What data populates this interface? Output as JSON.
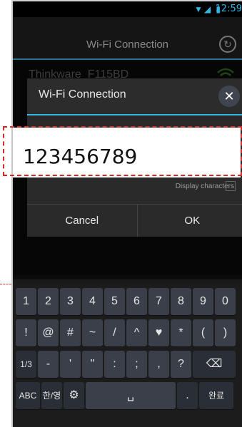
{
  "status_bar": {
    "time": "12:59"
  },
  "app_bar": {
    "title": "Wi-Fi Connection"
  },
  "network": {
    "name": "Thinkware_F115BD"
  },
  "dialog": {
    "title": "Wi-Fi Connection",
    "password_value": "123456789",
    "display_characters_label": "Display characters",
    "cancel_label": "Cancel",
    "ok_label": "OK"
  },
  "keyboard": {
    "row1": [
      "1",
      "2",
      "3",
      "4",
      "5",
      "6",
      "7",
      "8",
      "9",
      "0"
    ],
    "row2": [
      "!",
      "@",
      "#",
      "~",
      "/",
      "^",
      "♥",
      "*",
      "(",
      ")"
    ],
    "row3": [
      "1/3",
      "-",
      "'",
      "\"",
      ":",
      ";",
      ",",
      "?",
      "⌫"
    ],
    "row4": [
      "ABC",
      "한/영",
      "⚙",
      "␣",
      ".",
      "완료"
    ]
  },
  "colors": {
    "accent": "#33b5e5",
    "highlight": "#d42a2a",
    "key": "#3a3f4a"
  }
}
